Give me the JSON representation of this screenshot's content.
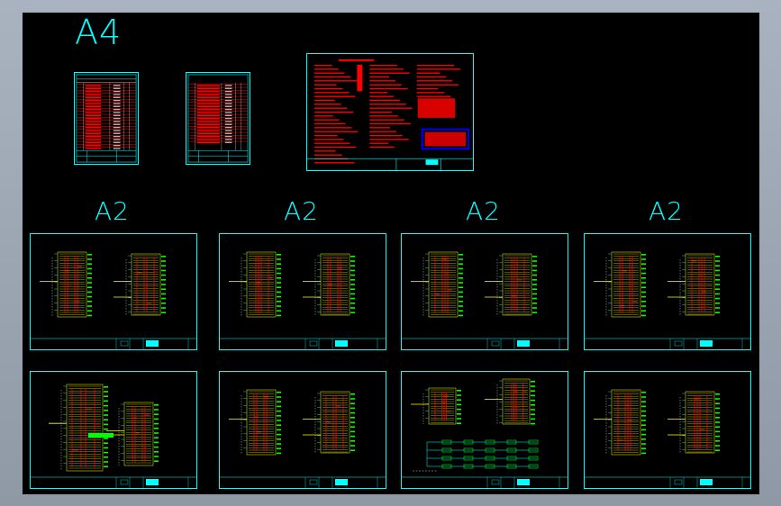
{
  "canvas": {
    "background": "#000000",
    "frame_color": "#00ffff"
  },
  "size_labels": {
    "a4": "A4",
    "a2_1": "A2",
    "a2_2": "A2",
    "a2_3": "A2",
    "a2_4": "A2"
  },
  "colors": {
    "cyan": "#00ffff",
    "red": "#ff0000",
    "yellow": "#ffff00",
    "green": "#00ff00",
    "blue": "#0000ff",
    "white": "#ffffff"
  },
  "icons": {
    "sheet": "drawing-sheet-icon"
  }
}
